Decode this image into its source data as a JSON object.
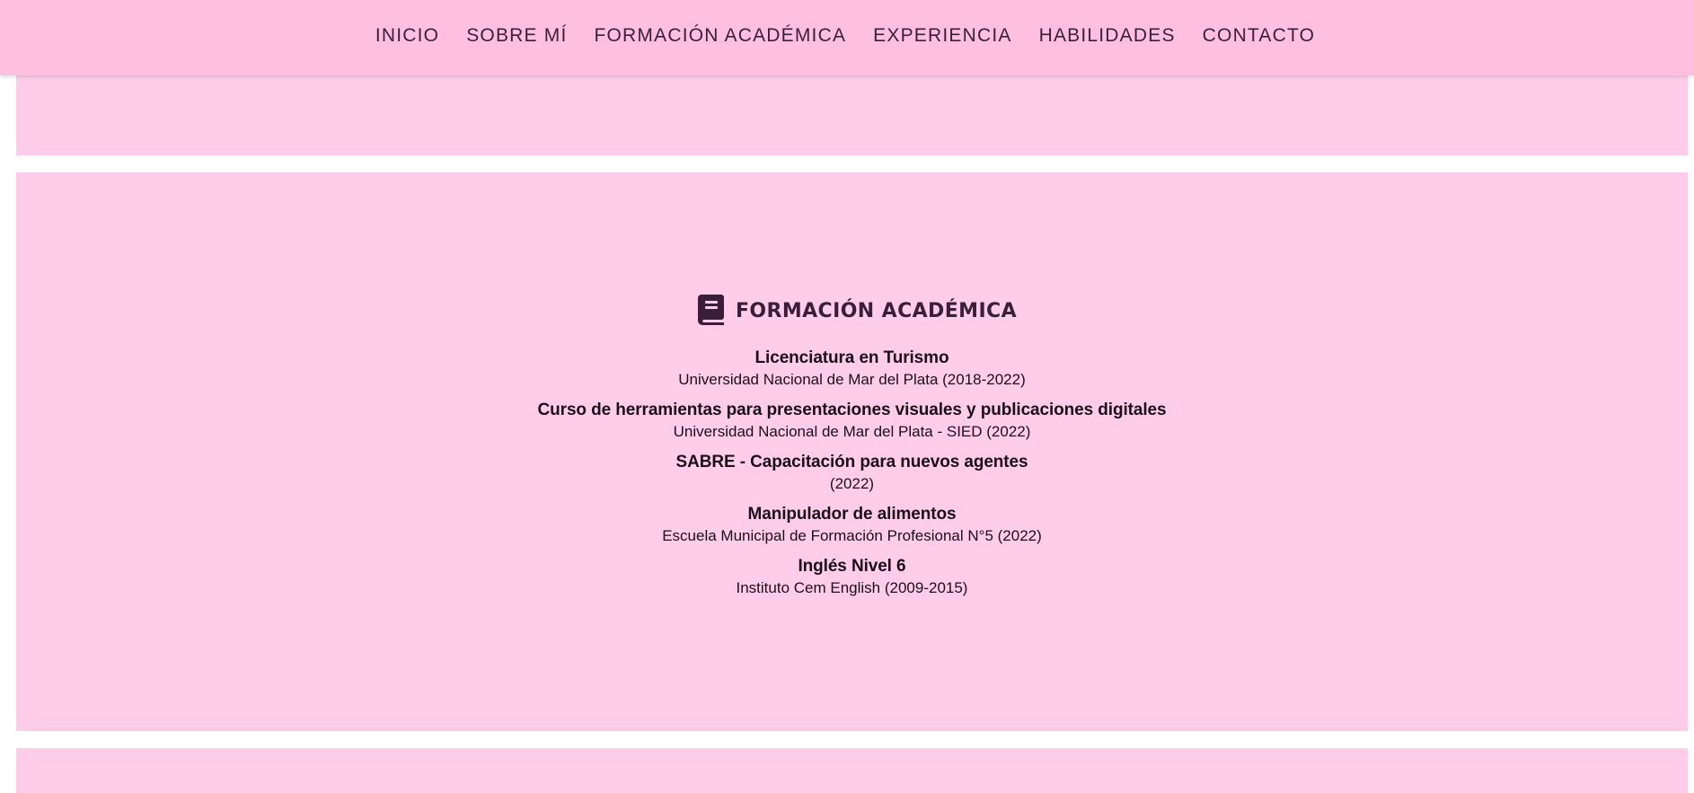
{
  "nav": {
    "items": [
      {
        "label": "INICIO"
      },
      {
        "label": "SOBRE MÍ"
      },
      {
        "label": "FORMACIÓN ACADÉMICA"
      },
      {
        "label": "EXPERIENCIA"
      },
      {
        "label": "HABILIDADES"
      },
      {
        "label": "CONTACTO"
      }
    ]
  },
  "section": {
    "icon": "book-icon",
    "title": "FORMACIÓN ACADÉMICA"
  },
  "education": [
    {
      "title": "Licenciatura en Turismo",
      "subtitle": "Universidad Nacional de Mar del Plata (2018-2022)"
    },
    {
      "title": "Curso de herramientas para presentaciones visuales y publicaciones digitales",
      "subtitle": "Universidad Nacional de Mar del Plata - SIED (2022)"
    },
    {
      "title": "SABRE - Capacitación para nuevos agentes",
      "subtitle": "(2022)"
    },
    {
      "title": "Manipulador de alimentos",
      "subtitle": "Escuela Municipal de Formación Profesional N°5 (2022)"
    },
    {
      "title": "Inglés Nivel 6",
      "subtitle": "Instituto Cem English (2009-2015)"
    }
  ],
  "colors": {
    "navbar": "#ffbfe0",
    "panel": "#ffcde9",
    "text_dark": "#3a1f3a"
  }
}
